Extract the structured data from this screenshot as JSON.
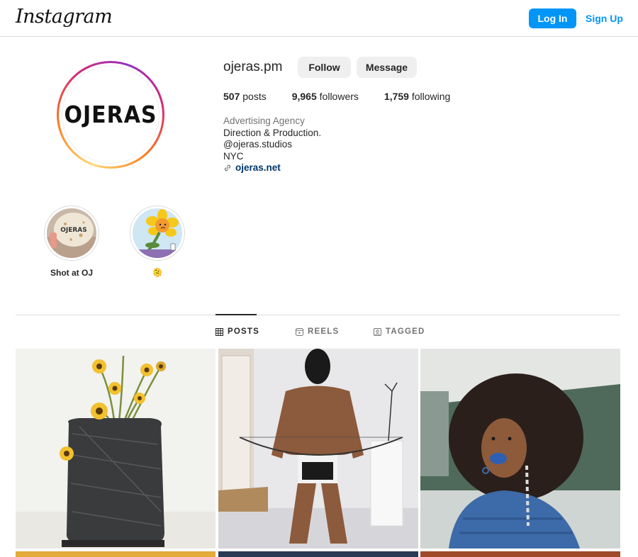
{
  "header": {
    "logo": "Instagram",
    "login_label": "Log In",
    "signup_label": "Sign Up"
  },
  "profile": {
    "username": "ojeras.pm",
    "avatar_text": "OJERAS",
    "follow_label": "Follow",
    "message_label": "Message",
    "stats": {
      "posts": "507",
      "posts_label": "posts",
      "followers": "9,965",
      "followers_label": "followers",
      "following": "1,759",
      "following_label": "following"
    },
    "bio": {
      "category": "Advertising Agency",
      "line1": "Direction & Production.",
      "line2": "@ojeras.studios",
      "line3": "NYC",
      "link": "ojeras.net"
    }
  },
  "highlights": [
    {
      "label": "Shot at OJ",
      "icon": "tortilla-photo"
    },
    {
      "label": "🫠",
      "icon": "sunflower-cartoon"
    }
  ],
  "tabs": [
    {
      "label": "POSTS",
      "icon": "grid-icon",
      "active": true
    },
    {
      "label": "REELS",
      "icon": "reels-icon",
      "active": false
    },
    {
      "label": "TAGGED",
      "icon": "tagged-icon",
      "active": false
    }
  ],
  "posts": [
    {
      "desc": "sunflowers in wrapped vase",
      "multi": true
    },
    {
      "desc": "masked figure with bow",
      "multi": false
    },
    {
      "desc": "woman with blue lips",
      "multi": true
    }
  ],
  "colors": {
    "accent": "#0095f6",
    "link": "#00376b",
    "button_bg": "#efefef",
    "border": "#dbdbdb"
  }
}
